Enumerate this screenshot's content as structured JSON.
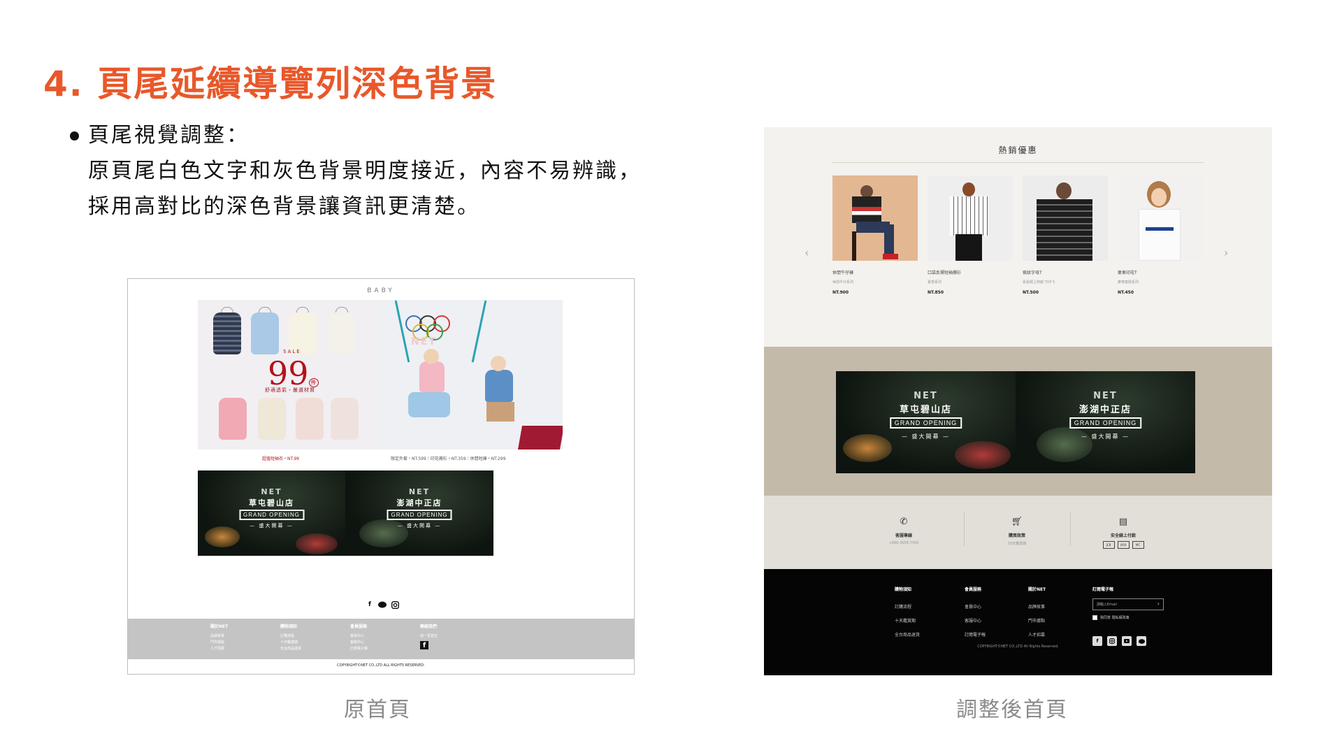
{
  "heading": "4. 頁尾延續導覽列深色背景",
  "bullet": {
    "line1": "頁尾視覺調整：",
    "line2": "原頁尾白色文字和灰色背景明度接近，內容不易辨識，",
    "line3": "採用高對比的深色背景讓資訊更清楚。"
  },
  "captions": {
    "left": "原首頁",
    "right": "調整後首頁"
  },
  "old_page": {
    "section_label": "BABY",
    "sale": {
      "small": "SALE",
      "big": "99",
      "unit": "件",
      "sub": "舒適透氣・嚴選材質"
    },
    "promo_captions": {
      "left": "超值短袖衣・NT.99",
      "right": "限定外套・NT.599｜印花襯衫・NT.359｜休閒短褲・NT.299"
    },
    "kids_logo": "NET",
    "stores": [
      {
        "net": "NET",
        "name": "草屯碧山店",
        "go": "GRAND OPENING",
        "sub": "— 盛大開幕 —"
      },
      {
        "net": "NET",
        "name": "澎湖中正店",
        "go": "GRAND OPENING",
        "sub": "— 盛大開幕 —"
      }
    ],
    "social_icons": [
      "facebook-icon",
      "line-icon",
      "instagram-icon"
    ],
    "footer_cols": [
      {
        "title": "關於NET",
        "items": [
          "品牌故事",
          "門市據點",
          "人才招募"
        ]
      },
      {
        "title": "購物須知",
        "items": [
          "訂購流程",
          "十天鑑賞期",
          "全台商品退貨"
        ]
      },
      {
        "title": "會員服務",
        "items": [
          "會員中心",
          "客服中心",
          "訂閱電子報"
        ]
      },
      {
        "title": "聯絡我們",
        "items": [
          "週一至週五"
        ]
      }
    ],
    "copyright": "COPYRIGHT©NET CO.,LTD ALL RIGHTS RESERVED."
  },
  "new_page": {
    "section_title": "熱銷優惠",
    "products": [
      {
        "name": "休閒牛仔褲",
        "desc": "休閒牛仔系列",
        "price": "NT.900"
      },
      {
        "name": "口袋反摺短袖襯衫",
        "desc": "夏季系列",
        "price": "NT.850"
      },
      {
        "name": "條紋字母T",
        "desc": "看看網上熱銷 TOP 5",
        "price": "NT.500"
      },
      {
        "name": "麥車印花T",
        "desc": "麥車童裝系列",
        "price": "NT.450"
      }
    ],
    "arrows": {
      "prev": "‹",
      "next": "›"
    },
    "stores": [
      {
        "net": "NET",
        "name": "草屯碧山店",
        "go": "GRAND OPENING",
        "sub": "— 盛大開幕 —"
      },
      {
        "net": "NET",
        "name": "澎湖中正店",
        "go": "GRAND OPENING",
        "sub": "— 盛大開幕 —"
      }
    ],
    "services": [
      {
        "icon": "phone-icon",
        "title": "客服專線",
        "sub": "+886-3658-7500"
      },
      {
        "icon": "cart-icon",
        "title": "購買政策",
        "sub": "10天鑑賞期"
      },
      {
        "icon": "card-icon",
        "title": "安全線上付款",
        "cards": [
          "JCB",
          "VISA",
          "MC"
        ]
      }
    ],
    "footer_cols": [
      {
        "title": "購物須知",
        "items": [
          "訂購流程",
          "十天鑑賞期",
          "全台商品退貨"
        ]
      },
      {
        "title": "會員服務",
        "items": [
          "會員中心",
          "客服中心",
          "訂閱電子報"
        ]
      },
      {
        "title": "關於NET",
        "items": [
          "品牌故事",
          "門市據點",
          "人才招募"
        ]
      }
    ],
    "newsletter": {
      "title": "訂閱電子報",
      "placeholder": "請輸入Email",
      "agree": "我同意 隱私權政策"
    },
    "social_icons": [
      "facebook-icon",
      "instagram-icon",
      "youtube-icon",
      "line-icon"
    ],
    "copyright": "COPYRIGHT©NET CO.,LTD All Rights Reserved."
  }
}
